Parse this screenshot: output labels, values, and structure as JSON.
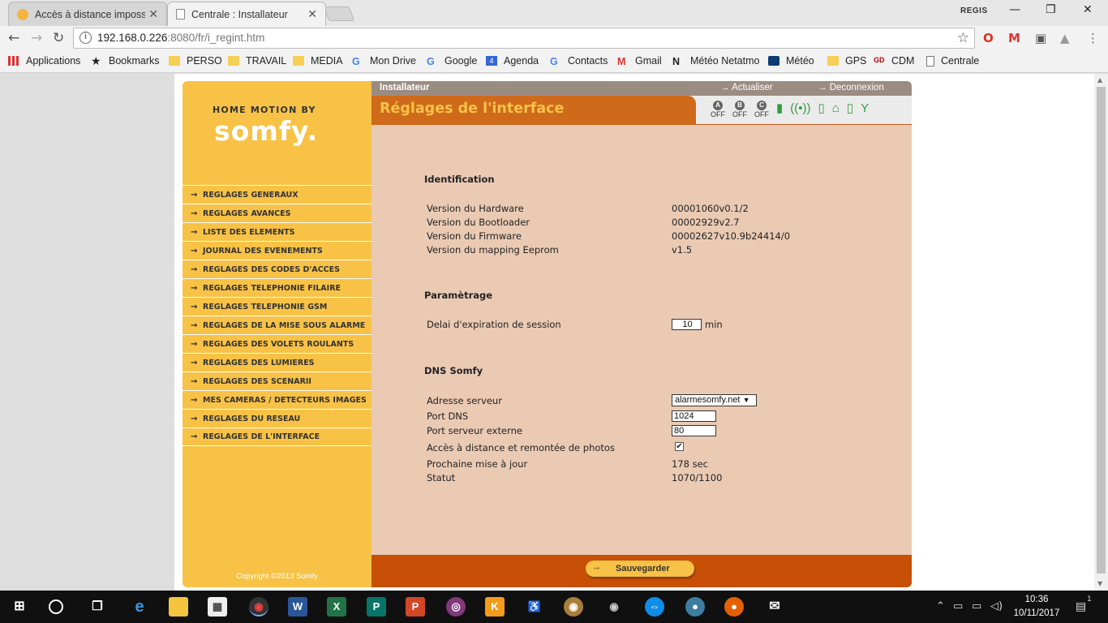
{
  "browser": {
    "tabs": [
      {
        "title": "Accès à distance impossi"
      },
      {
        "title": "Centrale : Installateur"
      }
    ],
    "user_badge": "REGIS",
    "url_host": "192.168.0.226",
    "url_rest": ":8080/fr/i_regint.htm",
    "bookmarks": [
      "Applications",
      "Bookmarks",
      "PERSO",
      "TRAVAIL",
      "MEDIA",
      "Mon Drive",
      "Google",
      "Agenda",
      "Contacts",
      "Gmail",
      "Météo Netatmo",
      "Météo",
      "GPS",
      "CDM",
      "Centrale"
    ],
    "calendar_day": "4"
  },
  "header": {
    "section": "Installateur",
    "refresh": "Actualiser",
    "logout": "Deconnexion",
    "page_title": "Réglages de l'interface"
  },
  "status_icons": {
    "a": "A",
    "b": "B",
    "c": "C",
    "a_state": "OFF",
    "b_state": "OFF",
    "c_state": "OFF"
  },
  "logo": {
    "top": "HOME MOTION BY",
    "main": "somfy."
  },
  "menu": [
    "REGLAGES GENERAUX",
    "REGLAGES AVANCES",
    "LISTE DES ELEMENTS",
    "JOURNAL DES EVENEMENTS",
    "REGLAGES DES CODES D'ACCES",
    "REGLAGES TELEPHONIE FILAIRE",
    "REGLAGES TELEPHONIE GSM",
    "REGLAGES DE LA MISE SOUS ALARME",
    "REGLAGES DES VOLETS ROULANTS",
    "REGLAGES DES LUMIERES",
    "REGLAGES DES SCENARII",
    "MES CAMERAS / DETECTEURS IMAGES",
    "REGLAGES DU RESEAU",
    "REGLAGES DE L'INTERFACE"
  ],
  "copyright": "Copyright ©2013 Somfy",
  "identification": {
    "title": "Identification",
    "rows": [
      {
        "label": "Version du Hardware",
        "value": "00001060v0.1/2"
      },
      {
        "label": "Version du Bootloader",
        "value": "00002929v2.7"
      },
      {
        "label": "Version du Firmware",
        "value": "00002627v10.9b24414/0"
      },
      {
        "label": "Version du mapping Eeprom",
        "value": "v1.5"
      }
    ]
  },
  "parametrage": {
    "title": "Paramètrage",
    "session_label": "Delai d'expiration de session",
    "session_value": "10",
    "session_unit": "min"
  },
  "dns": {
    "title": "DNS Somfy",
    "server_label": "Adresse serveur",
    "server_value": "alarmesomfy.net",
    "port_dns_label": "Port DNS",
    "port_dns_value": "1024",
    "port_ext_label": "Port serveur externe",
    "port_ext_value": "80",
    "remote_label": "Accès à distance et remontée de photos",
    "remote_checked": true,
    "next_update_label": "Prochaine mise à jour",
    "next_update_value": "178 sec",
    "status_label": "Statut",
    "status_value": "1070/1100"
  },
  "save_label": "Sauvegarder",
  "taskbar": {
    "time": "10:36",
    "date": "10/11/2017",
    "notifications": "1"
  }
}
